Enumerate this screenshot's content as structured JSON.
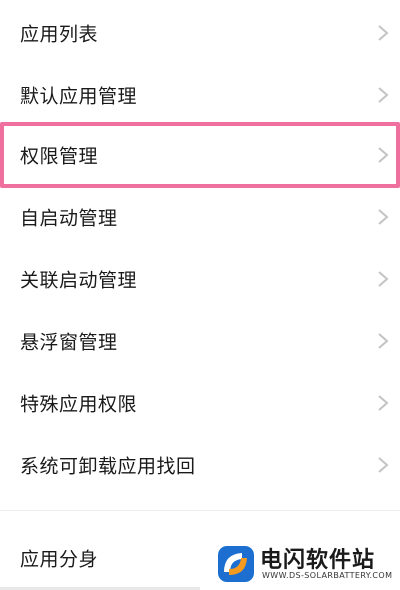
{
  "menu": {
    "items": [
      {
        "label": "应用列表"
      },
      {
        "label": "默认应用管理"
      },
      {
        "label": "权限管理"
      },
      {
        "label": "自启动管理"
      },
      {
        "label": "关联启动管理"
      },
      {
        "label": "悬浮窗管理"
      },
      {
        "label": "特殊应用权限"
      },
      {
        "label": "系统可卸载应用找回"
      },
      {
        "label": "应用分身"
      }
    ]
  },
  "watermark": {
    "title": "电闪软件站",
    "url": "WWW.DS-SOLARBATTERY.COM"
  },
  "icons": {
    "row_chevron": "chevron-right-icon",
    "watermark_logo": "ds-logo"
  },
  "colors": {
    "highlight_border": "#ef6f9e",
    "chevron": "#c4c4c4",
    "logo_blue": "#1c6fd1",
    "logo_orange": "#f39a1f"
  }
}
